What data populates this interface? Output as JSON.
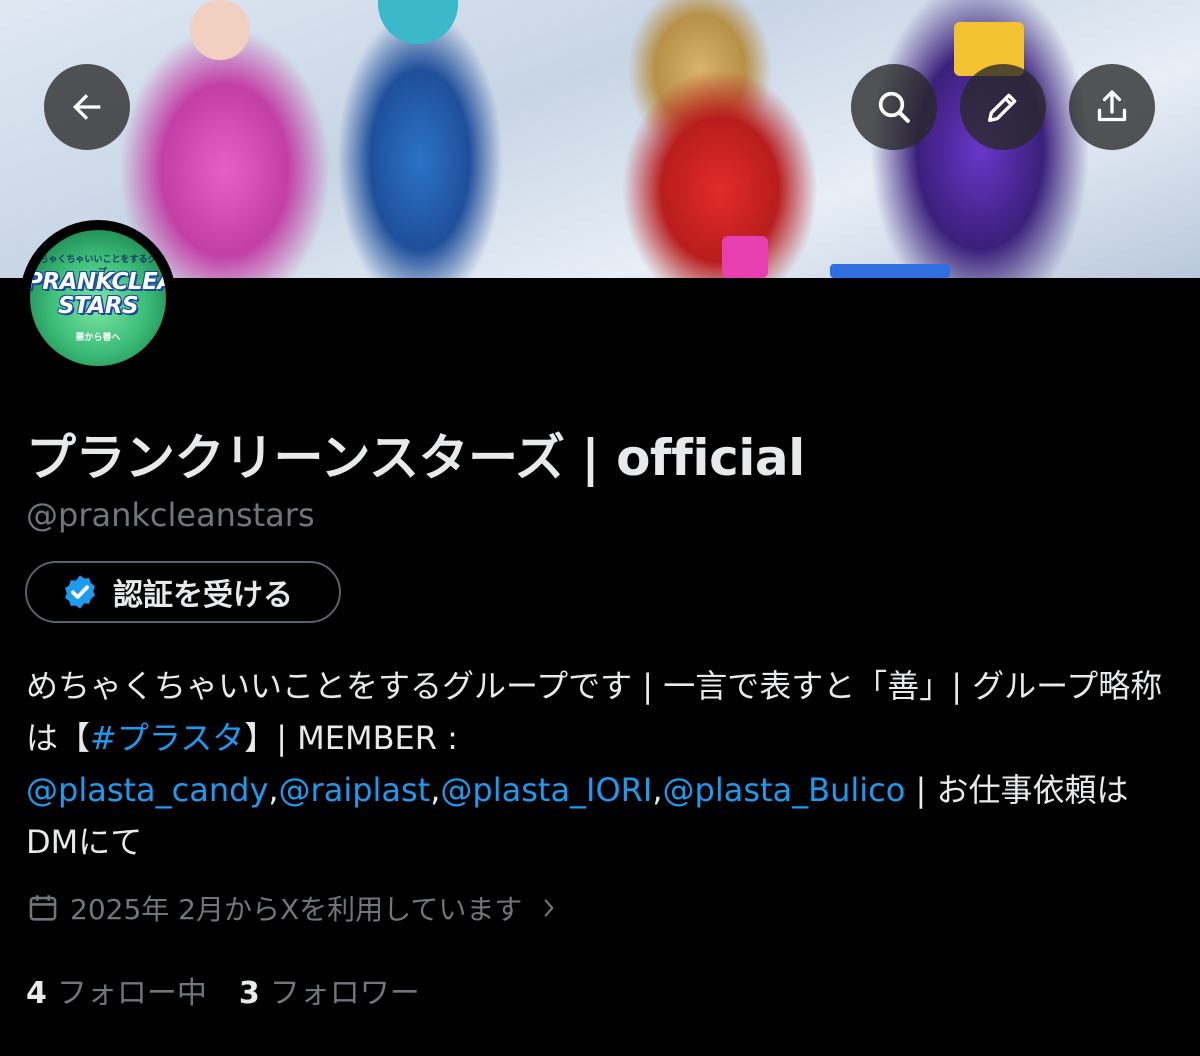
{
  "header": {
    "back_icon": "arrow-left-icon",
    "search_icon": "search-icon",
    "edit_icon": "pencil-icon",
    "share_icon": "share-icon"
  },
  "avatar": {
    "logo_top": "めちゃくちゃいいことをするグループ",
    "logo_line1": "PRANKCLEAN",
    "logo_line2": "STARS",
    "logo_bottom": "悪から善へ"
  },
  "profile": {
    "display_name": "プランクリーンスターズ | official",
    "handle": "@prankcleanstars",
    "verify_label": "認証を受ける",
    "bio": {
      "part1": "めちゃくちゃいいことをするグループです | 一言で表すと「善」| グループ略称は【",
      "hashtag": "#プラスタ",
      "part2": "】| MEMBER : ",
      "mention1": "@plasta_candy",
      "sep1": ",",
      "mention2": "@raiplast",
      "sep2": ",",
      "mention3": "@plasta_IORI",
      "sep3": ",",
      "mention4": "@plasta_Bulico",
      "part3": " | お仕事依頼はDMにて"
    },
    "joined": "2025年 2月からXを利用しています",
    "following_count": "4",
    "following_label": "フォロー中",
    "followers_count": "3",
    "followers_label": "フォロワー"
  },
  "colors": {
    "background": "#000000",
    "text": "#e7e9ea",
    "muted": "#71767b",
    "link": "#1d9bf0",
    "verify_badge": "#1d9bf0"
  }
}
